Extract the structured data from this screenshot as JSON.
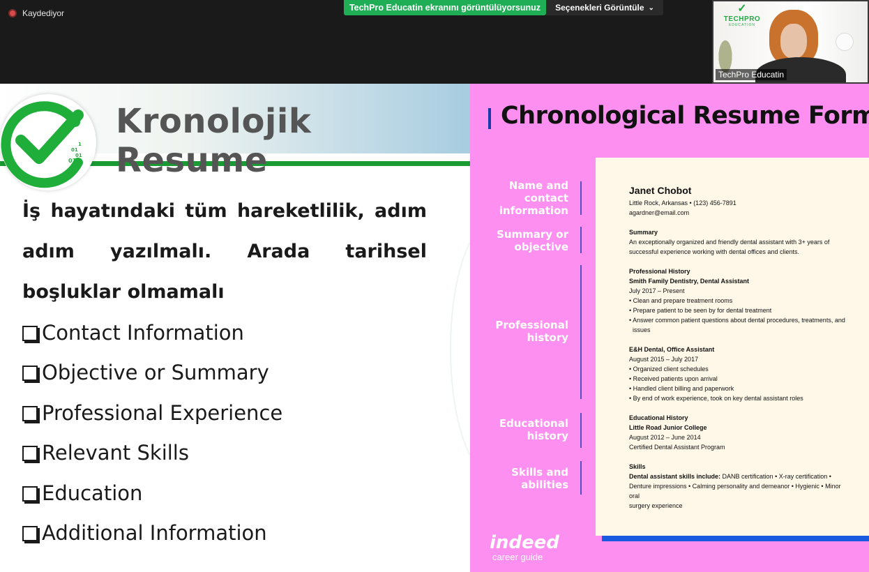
{
  "topbar": {
    "recording_label": "Kaydediyor",
    "share_banner": "TechPro Educatin ekranını görüntülüyorsunuz",
    "view_options_label": "Seçenekleri Görüntüle"
  },
  "video": {
    "participant_name": "TechPro Educatin",
    "logo_line1": "TECHPRO",
    "logo_line2": "EDUCATION"
  },
  "slide_left": {
    "title": "Kronolojik Resume",
    "logo_digits": [
      "1",
      "01",
      "01",
      "01"
    ],
    "body_text": "İş hayatındaki tüm hareketlilik, adım adım yazılmalı. Arada tarihsel boşluklar olmamalı",
    "checklist": [
      "Contact Information",
      "Objective or Summary",
      "Professional Experience",
      "Relevant Skills",
      "Education",
      "Additional Information"
    ]
  },
  "slide_right": {
    "title": "Chronological Resume Form",
    "sections": {
      "name": "Name and contact information",
      "summary": "Summary or objective",
      "professional": "Professional history",
      "education": "Educational history",
      "skills": "Skills and abilities"
    },
    "resume": {
      "name": "Janet Chobot",
      "address": "Little Rock, Arkansas • (123) 456-7891",
      "email": "agardner@email.com",
      "summary_head": "Summary",
      "summary_text_1": "An exceptionally organized and friendly dental assistant with 3+ years of",
      "summary_text_2": "successful experience working with dental offices and clients.",
      "prof_head": "Professional History",
      "job1_title": "Smith Family Dentistry, Dental Assistant",
      "job1_dates": "July 2017 – Present",
      "job1_b1": "• Clean and prepare treatment rooms",
      "job1_b2": "• Prepare patient to be seen by for dental treatment",
      "job1_b3a": "• Answer common patient questions about dental procedures, treatments, and",
      "job1_b3b": "issues",
      "job2_title": "E&H Dental, Office Assistant",
      "job2_dates": "August 2015 – July 2017",
      "job2_b1": "• Organized client schedules",
      "job2_b2": "• Received patients upon arrival",
      "job2_b3": "• Handled client billing and paperwork",
      "job2_b4": "• By end of work experience, took on key dental assistant roles",
      "edu_head": "Educational History",
      "edu_school": "Little Road Junior College",
      "edu_dates": "August 2012 – June 2014",
      "edu_program": "Certified Dental Assistant Program",
      "skills_head": "Skills",
      "skills_bold": "Dental assistant skills include:",
      "skills_text_1": " DANB certification • X-ray certification •",
      "skills_text_2": "Denture impressions • Calming personality and demeanor • Hygienic • Minor oral",
      "skills_text_3": "surgery experience"
    },
    "brand": "indeed",
    "brand_sub": "career guide"
  },
  "colors": {
    "zoom_green": "#1fae56",
    "slide_green": "#1a9a32",
    "pink": "#fc8ff0",
    "resume_bg": "#fff8e8",
    "title_grey": "#555555",
    "accent_blue": "#1a5ae0"
  }
}
